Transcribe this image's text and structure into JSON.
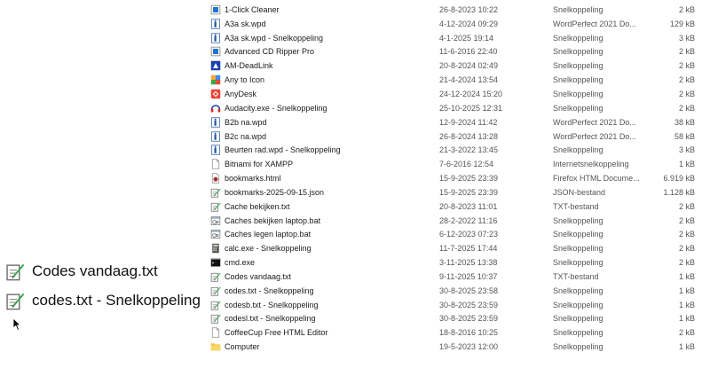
{
  "drag_items": [
    {
      "name": "Codes vandaag.txt",
      "icon": "txt-notepad-icon"
    },
    {
      "name": "codes.txt - Snelkoppeling",
      "icon": "txt-notepad-icon"
    }
  ],
  "files": [
    {
      "name": "1-Click Cleaner",
      "date": "26-8-2023 10:22",
      "type": "Snelkoppeling",
      "size": "2 kB",
      "icon": "app-blue-icon"
    },
    {
      "name": "A3a sk.wpd",
      "date": "4-12-2024 09:29",
      "type": "WordPerfect 2021 Do...",
      "size": "129 kB",
      "icon": "wpd-icon"
    },
    {
      "name": "A3a sk.wpd - Snelkoppeling",
      "date": "4-1-2025 19:14",
      "type": "Snelkoppeling",
      "size": "3 kB",
      "icon": "wpd-icon"
    },
    {
      "name": "Advanced CD Ripper Pro",
      "date": "11-6-2016 22:40",
      "type": "Snelkoppeling",
      "size": "2 kB",
      "icon": "app-blue-icon"
    },
    {
      "name": "AM-DeadLink",
      "date": "20-8-2024 02:49",
      "type": "Snelkoppeling",
      "size": "2 kB",
      "icon": "deadlink-icon"
    },
    {
      "name": "Any to Icon",
      "date": "21-4-2024 13:54",
      "type": "Snelkoppeling",
      "size": "2 kB",
      "icon": "anytoicon-icon"
    },
    {
      "name": "AnyDesk",
      "date": "24-12-2024 15:20",
      "type": "Snelkoppeling",
      "size": "2 kB",
      "icon": "anydesk-icon"
    },
    {
      "name": "Audacity.exe - Snelkoppeling",
      "date": "25-10-2025 12:31",
      "type": "Snelkoppeling",
      "size": "2 kB",
      "icon": "audacity-icon"
    },
    {
      "name": "B2b na.wpd",
      "date": "12-9-2024 11:42",
      "type": "WordPerfect 2021 Do...",
      "size": "38 kB",
      "icon": "wpd-icon"
    },
    {
      "name": "B2c na.wpd",
      "date": "26-8-2024 13:28",
      "type": "WordPerfect 2021 Do...",
      "size": "58 kB",
      "icon": "wpd-icon"
    },
    {
      "name": "Beurten rad.wpd - Snelkoppeling",
      "date": "21-3-2022 13:45",
      "type": "Snelkoppeling",
      "size": "3 kB",
      "icon": "wpd-icon"
    },
    {
      "name": "Bitnami for XAMPP",
      "date": "7-6-2016 12:54",
      "type": "Internetsnelkoppeling",
      "size": "1 kB",
      "icon": "blank-page-icon"
    },
    {
      "name": "bookmarks.html",
      "date": "15-9-2025 23:39",
      "type": "Firefox HTML Docume...",
      "size": "6.919 kB",
      "icon": "html-doc-icon"
    },
    {
      "name": "bookmarks-2025-09-15.json",
      "date": "15-9-2025 23:39",
      "type": "JSON-bestand",
      "size": "1.128 kB",
      "icon": "txt-notepad-icon"
    },
    {
      "name": "Cache bekijken.txt",
      "date": "20-8-2023 11:01",
      "type": "TXT-bestand",
      "size": "2 kB",
      "icon": "txt-notepad-icon"
    },
    {
      "name": "Caches bekijken laptop.bat",
      "date": "28-2-2022 11:16",
      "type": "Snelkoppeling",
      "size": "2 kB",
      "icon": "bat-icon"
    },
    {
      "name": "Caches legen laptop.bat",
      "date": "6-12-2023 07:23",
      "type": "Snelkoppeling",
      "size": "2 kB",
      "icon": "bat-icon"
    },
    {
      "name": "calc.exe - Snelkoppeling",
      "date": "11-7-2025 17:44",
      "type": "Snelkoppeling",
      "size": "2 kB",
      "icon": "calculator-icon"
    },
    {
      "name": "cmd.exe",
      "date": "3-11-2025 13:38",
      "type": "Snelkoppeling",
      "size": "2 kB",
      "icon": "cmd-icon"
    },
    {
      "name": "Codes vandaag.txt",
      "date": "9-11-2025 10:37",
      "type": "TXT-bestand",
      "size": "1 kB",
      "icon": "txt-notepad-icon"
    },
    {
      "name": "codes.txt - Snelkoppeling",
      "date": "30-8-2025 23:58",
      "type": "Snelkoppeling",
      "size": "1 kB",
      "icon": "txt-notepad-icon"
    },
    {
      "name": "codesb.txt - Snelkoppeling",
      "date": "30-8-2025 23:59",
      "type": "Snelkoppeling",
      "size": "1 kB",
      "icon": "txt-notepad-icon"
    },
    {
      "name": "codesl.txt - Snelkoppeling",
      "date": "30-8-2025 23:59",
      "type": "Snelkoppeling",
      "size": "1 kB",
      "icon": "txt-notepad-icon"
    },
    {
      "name": "CoffeeCup Free HTML Editor",
      "date": "18-8-2016 10:25",
      "type": "Snelkoppeling",
      "size": "2 kB",
      "icon": "blank-page-icon"
    },
    {
      "name": "Computer",
      "date": "19-5-2023 12:00",
      "type": "Snelkoppeling",
      "size": "1 kB",
      "icon": "folder-icon"
    }
  ]
}
